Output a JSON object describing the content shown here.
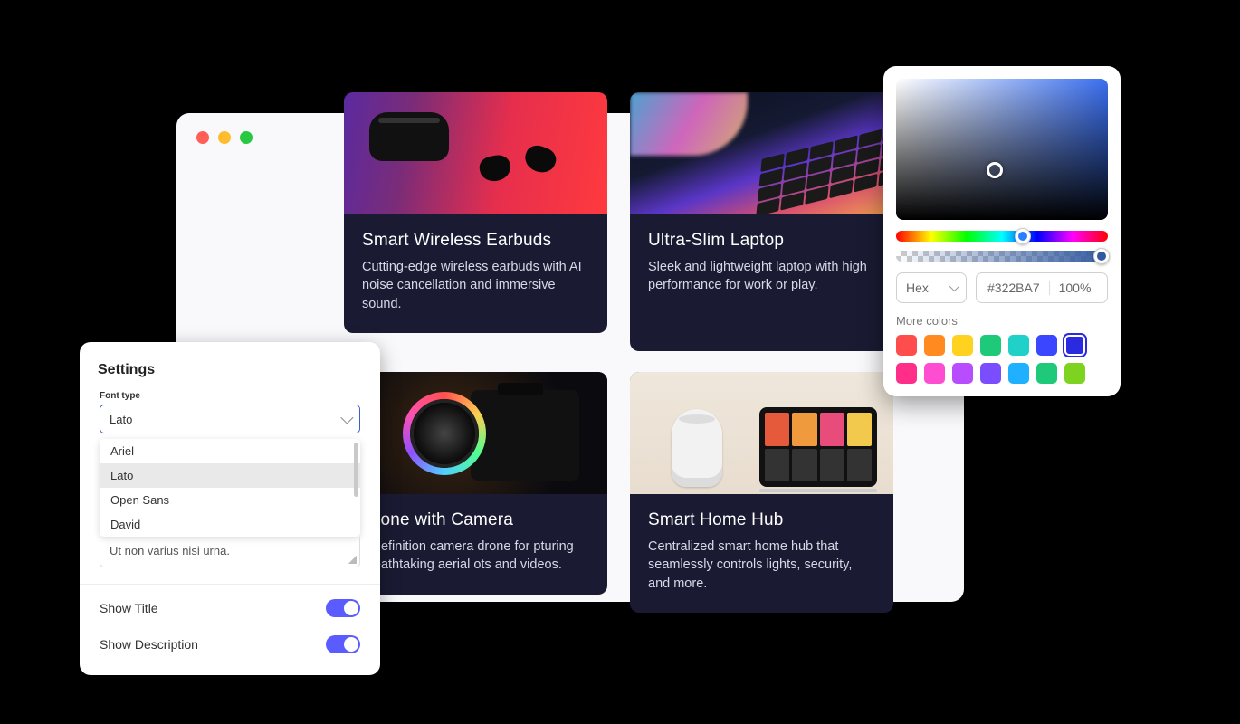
{
  "cards": [
    {
      "title": "Smart Wireless Earbuds",
      "desc": "Cutting-edge wireless earbuds with AI noise cancellation and immersive sound."
    },
    {
      "title": "Ultra-Slim Laptop",
      "desc": "Sleek and lightweight laptop with high performance for work or play."
    },
    {
      "title": "Drone with Camera",
      "desc": "High-definition camera drone for capturing breathtaking aerial shots and videos.",
      "title_cut": " Drone with Camera",
      "desc_cut": "h-definition camera drone for pturing breathtaking aerial ots and videos."
    },
    {
      "title": "Smart Home Hub",
      "desc": "Centralized smart home hub that seamlessly controls lights, security, and more."
    }
  ],
  "settings": {
    "heading": "Settings",
    "font_label": "Font type",
    "font_selected": "Lato",
    "font_options": [
      "Ariel",
      "Lato",
      "Open Sans",
      "David"
    ],
    "textarea_value": "Ut non varius nisi urna.",
    "show_title_label": "Show Title",
    "show_title_on": true,
    "show_description_label": "Show Description",
    "show_description_on": true
  },
  "picker": {
    "format": "Hex",
    "hex": "#322BA7",
    "opacity": "100%",
    "more_label": "More colors",
    "swatches_row1": [
      "#ff4d4d",
      "#ff8a1f",
      "#ffd21f",
      "#1fc97a",
      "#1fd1c9",
      "#3a46ff",
      "#2a2ae0"
    ],
    "swatches_row2": [
      "#ff2e88",
      "#ff4dd2",
      "#b84dff",
      "#7a4dff",
      "#1fb0ff",
      "#1fc97a",
      "#7ed321"
    ],
    "active_swatch": "#2a2ae0"
  }
}
